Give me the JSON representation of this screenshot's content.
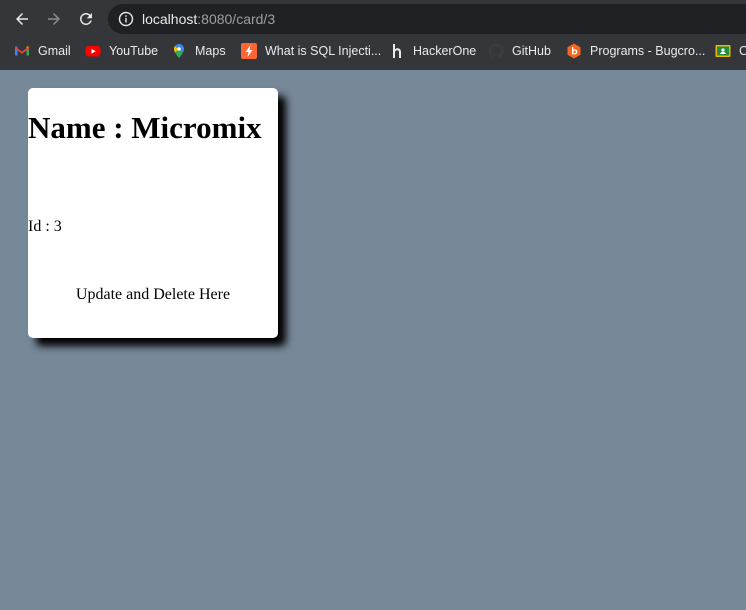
{
  "browser": {
    "url_host": "localhost",
    "url_path": ":8080/card/3",
    "bookmarks": [
      {
        "label": "Gmail",
        "icon": "gmail-icon"
      },
      {
        "label": "YouTube",
        "icon": "youtube-icon"
      },
      {
        "label": "Maps",
        "icon": "maps-icon"
      },
      {
        "label": "What is SQL Injecti...",
        "icon": "portswigger-icon"
      },
      {
        "label": "HackerOne",
        "icon": "hackerone-icon"
      },
      {
        "label": "GitHub",
        "icon": "github-icon"
      },
      {
        "label": "Programs - Bugcro...",
        "icon": "bugcrowd-icon"
      },
      {
        "label": "C",
        "icon": "classroom-icon"
      }
    ]
  },
  "card": {
    "title": "Name : Micromix",
    "id_text": "Id : 3",
    "action_text": "Update and Delete Here"
  },
  "colors": {
    "page_background": "#778899",
    "card_background": "#ffffff",
    "chrome_background": "#35363a"
  }
}
